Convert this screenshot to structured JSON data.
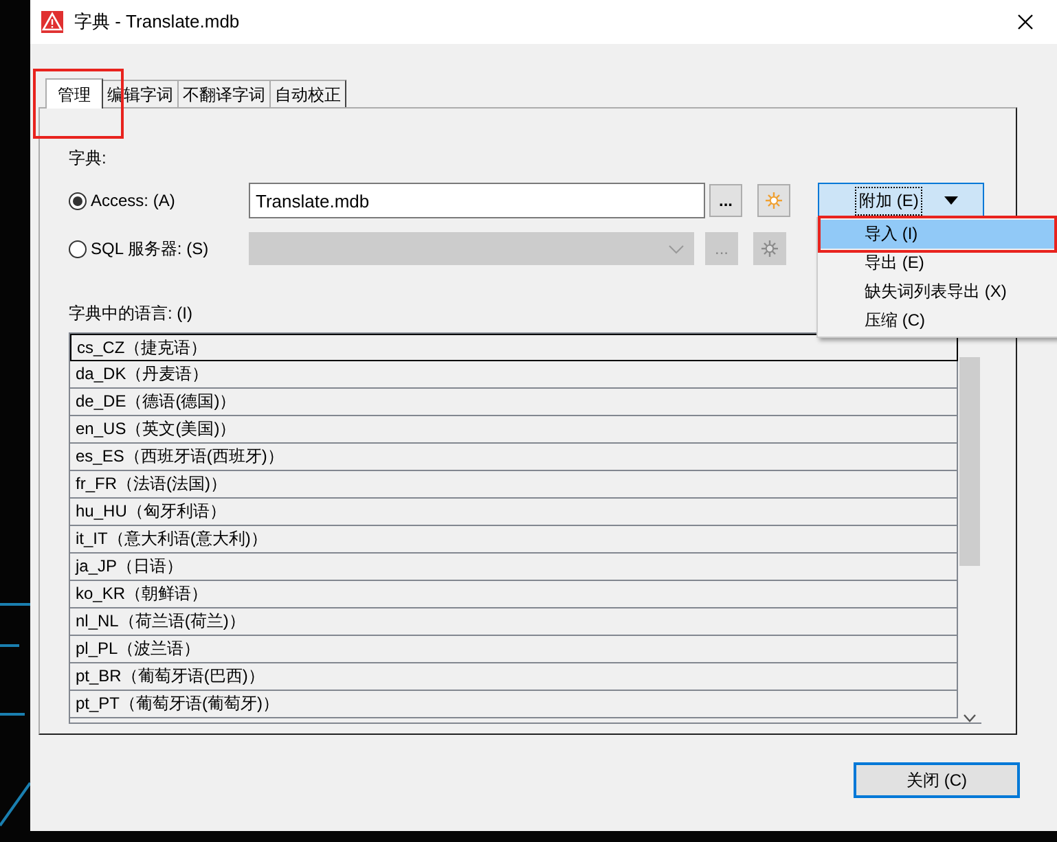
{
  "window": {
    "title": "字典 - Translate.mdb"
  },
  "tabs": [
    {
      "label": "管理",
      "selected": true,
      "highlighted": true
    },
    {
      "label": "编辑字词",
      "selected": false,
      "highlighted": false
    },
    {
      "label": "不翻译字词",
      "selected": false,
      "highlighted": false
    },
    {
      "label": "自动校正",
      "selected": false,
      "highlighted": false
    }
  ],
  "dictionary": {
    "label": "字典:",
    "sources": [
      {
        "kind": "access",
        "label": "Access: (A)",
        "selected": true,
        "disabled": false,
        "value": "Translate.mdb",
        "browse_label": "..."
      },
      {
        "kind": "sql",
        "label": "SQL 服务器: (S)",
        "selected": false,
        "disabled": true,
        "browse_label": "..."
      }
    ]
  },
  "attach_button": {
    "label": "附加 (E)"
  },
  "attach_menu": [
    {
      "label": "导入 (I)",
      "selected": true,
      "highlighted": true
    },
    {
      "label": "导出 (E)",
      "selected": false,
      "highlighted": false
    },
    {
      "label": "缺失词列表导出 (X)",
      "selected": false,
      "highlighted": false
    },
    {
      "label": "压缩 (C)",
      "selected": false,
      "highlighted": false
    }
  ],
  "languages": {
    "label": "字典中的语言: (I)",
    "items": [
      {
        "label": "cs_CZ（捷克语）",
        "selected": true
      },
      {
        "label": "da_DK（丹麦语）",
        "selected": false
      },
      {
        "label": "de_DE（德语(德国)）",
        "selected": false
      },
      {
        "label": "en_US（英文(美国)）",
        "selected": false
      },
      {
        "label": "es_ES（西班牙语(西班牙)）",
        "selected": false
      },
      {
        "label": "fr_FR（法语(法国)）",
        "selected": false
      },
      {
        "label": "hu_HU（匈牙利语）",
        "selected": false
      },
      {
        "label": "it_IT（意大利语(意大利)）",
        "selected": false
      },
      {
        "label": "ja_JP（日语）",
        "selected": false
      },
      {
        "label": "ko_KR（朝鲜语）",
        "selected": false
      },
      {
        "label": "nl_NL（荷兰语(荷兰)）",
        "selected": false
      },
      {
        "label": "pl_PL（波兰语）",
        "selected": false
      },
      {
        "label": "pt_BR（葡萄牙语(巴西)）",
        "selected": false
      },
      {
        "label": "pt_PT（葡萄牙语(葡萄牙)）",
        "selected": false
      }
    ]
  },
  "close_button": {
    "label": "关闭 (C)"
  }
}
